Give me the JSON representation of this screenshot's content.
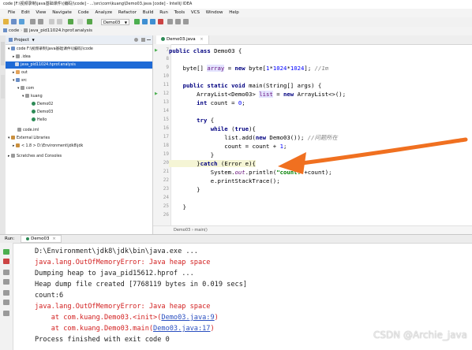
{
  "window": {
    "title": "code [F:\\视频录制\\java基础课件\\(编码)\\code] - ...\\src\\com\\kuang\\Demo03.java [code] - IntelliJ IDEA"
  },
  "menu": [
    "File",
    "Edit",
    "View",
    "Navigate",
    "Code",
    "Analyze",
    "Refactor",
    "Build",
    "Run",
    "Tools",
    "VCS",
    "Window",
    "Help"
  ],
  "toolbar": {
    "run_config": "Demo03"
  },
  "navbar": {
    "crumbs": [
      "code",
      "java_pid11024.hprof.analysis"
    ]
  },
  "project_panel": {
    "title": "Project",
    "rows": [
      {
        "label": "code  F:\\视频录制\\java基础课件\\(编码)\\code",
        "depth": 0,
        "selected": false
      },
      {
        "label": ".idea",
        "depth": 1,
        "selected": false
      },
      {
        "label": "java_pid11024.hprof.analysis",
        "depth": 1,
        "selected": true
      },
      {
        "label": "out",
        "depth": 1,
        "selected": false
      },
      {
        "label": "src",
        "depth": 1,
        "selected": false
      },
      {
        "label": "com",
        "depth": 2,
        "selected": false
      },
      {
        "label": "kuang",
        "depth": 3,
        "selected": false
      },
      {
        "label": "Demo02",
        "depth": 4,
        "selected": false
      },
      {
        "label": "Demo03",
        "depth": 4,
        "selected": false
      },
      {
        "label": "Hello",
        "depth": 4,
        "selected": false
      },
      {
        "label": "code.iml",
        "depth": 1,
        "selected": false
      },
      {
        "label": "External Libraries",
        "depth": 0,
        "selected": false
      },
      {
        "label": "< 1.8 >  D:\\Environment\\jdk8\\jdk",
        "depth": 1,
        "selected": false
      },
      {
        "label": "Scratches and Consoles",
        "depth": 0,
        "selected": false
      }
    ]
  },
  "editor": {
    "tab": "Demo03.java",
    "line_numbers": [
      "7",
      "8",
      "9",
      "10",
      "11",
      "12",
      "13",
      "14",
      "15",
      "16",
      "17",
      "18",
      "19",
      "20",
      "21",
      "22",
      "23",
      "24",
      "25",
      "26"
    ],
    "code_parts": {
      "l1_kw": "public class ",
      "l1_rest": "Demo03 {",
      "l3_t": "byte[] ",
      "l3_v": "array",
      "l3_a": " = ",
      "l3_new": "new ",
      "l3_b": "byte[",
      "l3_n1": "1",
      "l3_s1": "*",
      "l3_n2": "1024",
      "l3_s2": "*",
      "l3_n3": "1024",
      "l3_e": "]; ",
      "l3_cm": "//1m",
      "l5_kw": "public static void ",
      "l5_rest": "main(String[] args) {",
      "l6_a": "ArrayList<Demo03> ",
      "l6_v": "list",
      "l6_b": " = ",
      "l6_new": "new ",
      "l6_c": "ArrayList<>();",
      "l7_kw": "int ",
      "l7_a": "count = ",
      "l7_n": "0",
      "l7_b": ";",
      "l9_kw": "try ",
      "l9_b": "{",
      "l10_kw": "while ",
      "l10_a": "(",
      "l10_t": "true",
      "l10_b": "){",
      "l11_a": "list.add(",
      "l11_new": "new ",
      "l11_b": "Demo03()); ",
      "l11_cm": "//问题所在",
      "l12_a": "count = count + ",
      "l12_n": "1",
      "l12_b": ";",
      "l13": "}",
      "l14_a": "}",
      "l14_kw": "catch ",
      "l14_b": "(Error e){",
      "l15_a": "System.",
      "l15_out": "out",
      "l15_b": ".println(",
      "l15_s": "\"count:\"",
      "l15_c": "+count);",
      "l16": "e.printStackTrace();",
      "l17": "}",
      "l19": "}"
    },
    "breadcrumb": [
      "Demo03",
      "main()"
    ]
  },
  "run_panel": {
    "tab_label": "Run:",
    "tab": "Demo03",
    "lines": {
      "c1": "D:\\Environment\\jdk8\\jdk\\bin\\java.exe ...",
      "c2": "java.lang.OutOfMemoryError: Java heap space",
      "c3": "Dumping heap to java_pid15612.hprof ...",
      "c4": "Heap dump file created [7768119 bytes in 0.019 secs]",
      "c5": "count:6",
      "c6": "java.lang.OutOfMemoryError: Java heap space",
      "c7_a": "    at com.kuang.Demo03.<init>(",
      "c7_l": "Demo03.java:9",
      "c7_b": ")",
      "c8_a": "    at com.kuang.Demo03.main(",
      "c8_l": "Demo03.java:17",
      "c8_b": ")",
      "c9": "Process finished with exit code 0"
    }
  },
  "watermark": "CSDN @Archie_java",
  "colors": {
    "accent": "#1e6ad6",
    "arrow": "#f07020",
    "error_text": "#d21f1f",
    "link": "#2a4fc0"
  }
}
